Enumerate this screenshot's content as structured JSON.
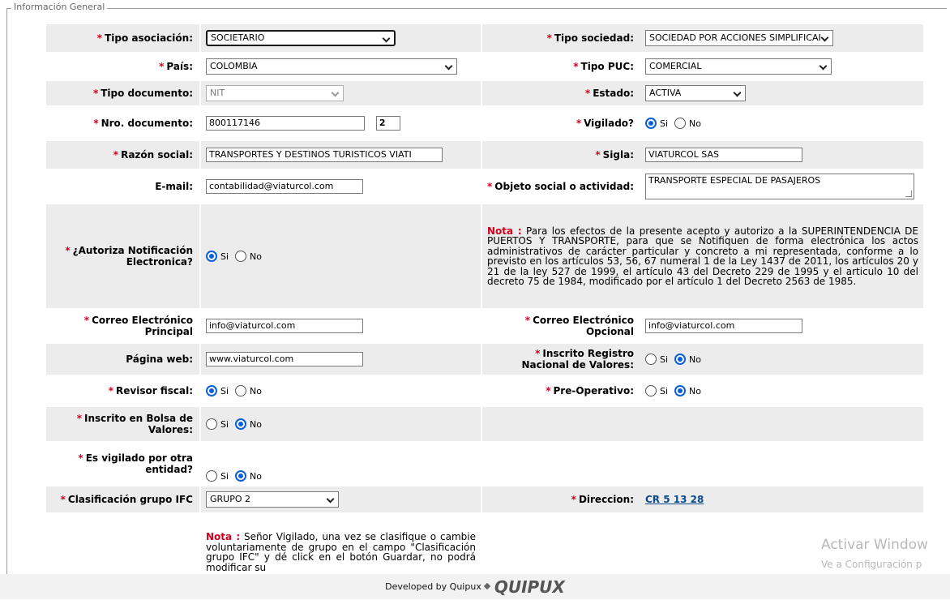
{
  "section_legend": "Información General",
  "required_mark": "*",
  "fields": {
    "tipo_asociacion": {
      "label": "Tipo asociación:",
      "value": "SOCIETARIO"
    },
    "tipo_sociedad": {
      "label": "Tipo sociedad:",
      "value": "SOCIEDAD POR ACCIONES SIMPLIFICAI"
    },
    "pais": {
      "label": "País:",
      "value": "COLOMBIA"
    },
    "tipo_puc": {
      "label": "Tipo PUC:",
      "value": "COMERCIAL"
    },
    "tipo_documento": {
      "label": "Tipo documento:",
      "value": "NIT"
    },
    "estado": {
      "label": "Estado:",
      "value": "ACTIVA"
    },
    "nro_documento": {
      "label": "Nro. documento:",
      "value": "800117146",
      "dv": "2"
    },
    "vigilado": {
      "label": "Vigilado?",
      "selected": "Si"
    },
    "razon_social": {
      "label": "Razón social:",
      "value": "TRANSPORTES Y DESTINOS TURISTICOS VIATI"
    },
    "sigla": {
      "label": "Sigla:",
      "value": "VIATURCOL SAS"
    },
    "email": {
      "label": "E-mail:",
      "value": "contabilidad@viaturcol.com"
    },
    "objeto_social": {
      "label": "Objeto social o actividad:",
      "value": "TRANSPORTE ESPECIAL DE PASAJEROS"
    },
    "autoriza_notificacion": {
      "label": "¿Autoriza Notificación Electronica?",
      "selected": "Si"
    },
    "correo_principal": {
      "label": "Correo Electrónico Principal",
      "value": "info@viaturcol.com"
    },
    "correo_opcional": {
      "label": "Correo Electrónico Opcional",
      "value": "info@viaturcol.com"
    },
    "pagina_web": {
      "label": "Página web:",
      "value": "www.viaturcol.com"
    },
    "registro_nacional": {
      "label": "Inscrito Registro Nacional de Valores:",
      "selected": "No"
    },
    "revisor_fiscal": {
      "label": "Revisor fiscal:",
      "selected": "Si"
    },
    "pre_operativo": {
      "label": "Pre-Operativo:",
      "selected": "No"
    },
    "bolsa_valores": {
      "label": "Inscrito en Bolsa de Valores:",
      "selected": "No"
    },
    "vigilado_otra": {
      "label": "Es vigilado por otra entidad?",
      "selected": "No"
    },
    "grupo_ifc": {
      "label": "Clasificación grupo IFC",
      "value": "GRUPO 2"
    },
    "direccion": {
      "label": "Direccion:",
      "value": "CR 5 13 28"
    }
  },
  "radio_labels": {
    "si": "Si",
    "no": "No"
  },
  "nota_label": "Nota :",
  "nota_autoriza": "Para los efectos de la presente acepto y autorizo a la SUPERINTENDENCIA DE PUERTOS Y TRANSPORTE, para que se Notifiquen de forma electrónica los actos administrativos de carácter particular y concreto a mi representada, conforme a lo previsto en los artículos 53, 56, 67 numeral 1 de la Ley 1437 de 2011, los artículos 20 y 21 de la ley 527 de 1999, el artículo 43 del Decreto 229 de 1995 y el articulo 10 del decreto 75 de 1984, modificado por el artículo 1 del Decreto 2563 de 1985.",
  "nota_grupo": "Señor Vigilado, una vez se clasifique o cambie voluntariamente de grupo en el campo \"Clasificación grupo IFC\" y dé click en el botón Guardar, no podrá modificar su",
  "footer": {
    "text": "Developed by Quipux",
    "logo": "QUIPUX"
  },
  "watermark": {
    "line1": "Activar Window",
    "line2": "Ve a Configuración p"
  }
}
